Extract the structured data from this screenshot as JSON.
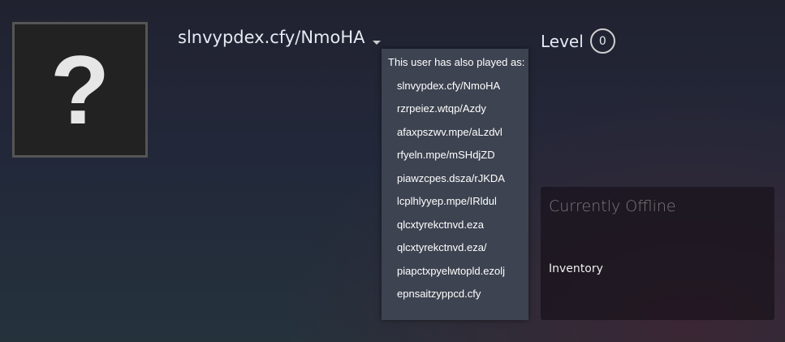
{
  "profile": {
    "name": "slnvypdex.cfy/NmoHA",
    "avatar_glyph": "?",
    "level_label": "Level",
    "level": "0"
  },
  "aliases": {
    "header": "This user has also played as:",
    "items": [
      "slnvypdex.cfy/NmoHA",
      "rzrpeiez.wtqp/Azdy",
      "afaxpszwv.mpe/aLzdvl",
      "rfyeln.mpe/mSHdjZD",
      "piawzcpes.dsza/rJKDA",
      "lcplhlyyep.mpe/IRldul",
      "qlcxtyrekctnvd.eza",
      "qlcxtyrekctnvd.eza/",
      "piapctxpyelwtopld.ezolj",
      "epnsaitzyppcd.cfy"
    ]
  },
  "panel": {
    "status": "Currently Offline",
    "inventory": "Inventory"
  }
}
